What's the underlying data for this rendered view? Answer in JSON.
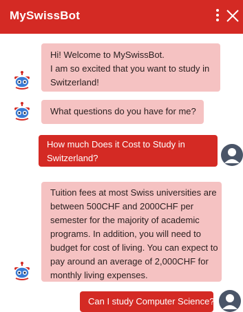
{
  "header": {
    "title": "MySwissBot",
    "menu_icon": "more-vertical-icon",
    "close_icon": "close-icon",
    "accent": "#d42a24"
  },
  "messages": [
    {
      "from": "bot",
      "lines": [
        "Hi! Welcome to MySwissBot.",
        "I am so excited that you want to study in",
        "Switzerland!"
      ]
    },
    {
      "from": "bot",
      "lines": [
        "What questions do you have for me?"
      ]
    },
    {
      "from": "user",
      "lines": [
        "How much Does it Cost to Study in",
        "Switzerland?"
      ]
    },
    {
      "from": "bot",
      "lines": [
        "Tuition fees at most Swiss universities are",
        "between 500CHF and 2000CHF per",
        "semester for the majority of academic",
        "programs. In addition, you will need to",
        "budget for cost of living. You can expect to",
        "pay around an average of 2,000CHF for",
        "monthly living expenses."
      ]
    },
    {
      "from": "user",
      "lines": [
        "Can I study Computer Science?"
      ]
    }
  ],
  "colors": {
    "bot_bubble": "#f5c2c2",
    "user_bubble": "#d42a24",
    "bot_avatar_icon": "robot-icon",
    "user_avatar_icon": "user-avatar-icon"
  }
}
